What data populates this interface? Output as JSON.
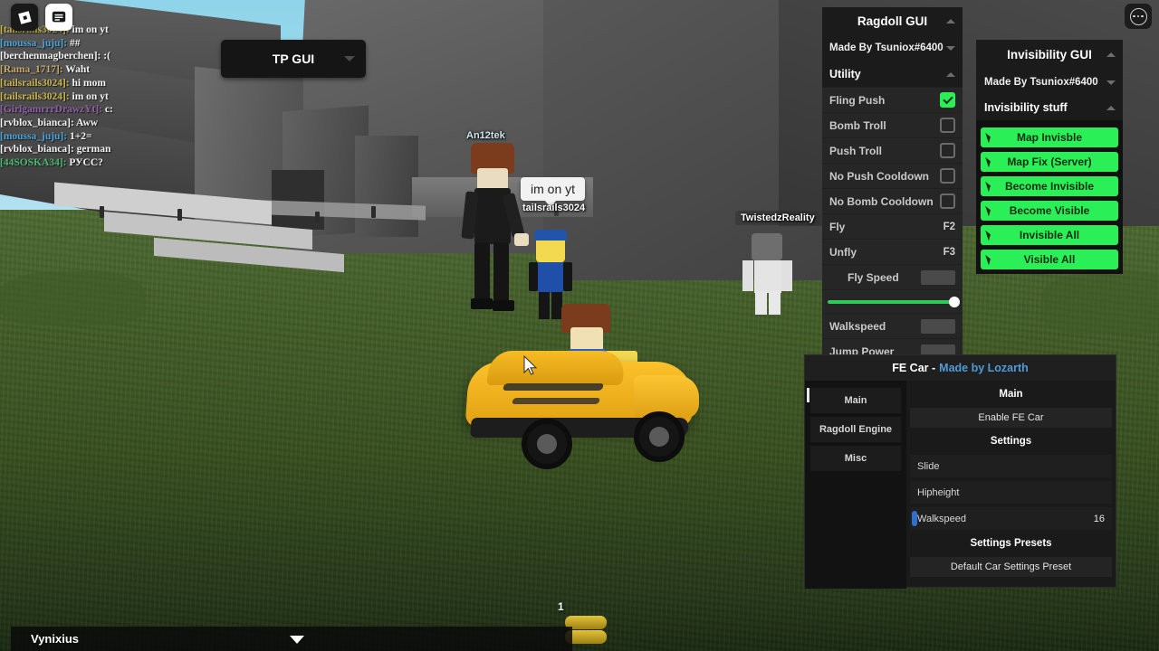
{
  "window": {
    "top_right_menu_icon": "ellipsis-circle-icon",
    "roblox_logo_icon": "roblox-logo-icon",
    "chat_toggle_icon": "chat-lines-icon"
  },
  "chat_log": {
    "lines": [
      {
        "name": "[tailsrails3024]:",
        "message": "im on yt",
        "color": "#c9b44a"
      },
      {
        "name": "[moussa_juju]:",
        "message": "##",
        "color": "#4aa3d8"
      },
      {
        "name": "[berchenmagberchen]:",
        "message": ":(",
        "color": "#f2f2f2"
      },
      {
        "name": "[Rama_1717]:",
        "message": "Waht",
        "color": "#c7a86a"
      },
      {
        "name": "[tailsrails3024]:",
        "message": "hi mom",
        "color": "#c9b44a"
      },
      {
        "name": "[tailsrails3024]:",
        "message": "im on yt",
        "color": "#c9b44a"
      },
      {
        "name": "[GirlgamrrrDrawzYt]:",
        "message": "c:",
        "color": "#8f5fa8"
      },
      {
        "name": "[rvblox_bianca]:",
        "message": "Aww",
        "color": "#f2f2f2"
      },
      {
        "name": "[moussa_juju]:",
        "message": "1+2=",
        "color": "#4aa3d8"
      },
      {
        "name": "[rvblox_bianca]:",
        "message": "german",
        "color": "#f2f2f2"
      },
      {
        "name": "[44SOSKA34]:",
        "message": "РУСС?",
        "color": "#46b96b"
      }
    ]
  },
  "tp_gui": {
    "label": "TP GUI",
    "caret_icon": "chevron-down-icon"
  },
  "world": {
    "nametags": [
      {
        "text": "An12tek"
      },
      {
        "text": "tailsrails3024"
      },
      {
        "text": "TwistedzReality"
      }
    ],
    "chat_bubble": "im on yt",
    "coin_count": "1"
  },
  "ragdoll_gui": {
    "title": "Ragdoll GUI",
    "author": "Made By Tsuniox#6400",
    "section": "Utility",
    "collapse_icon": "chevron-up-icon",
    "accent_color": "#2bef57",
    "toggles": [
      {
        "label": "Fling Push",
        "checked": true
      },
      {
        "label": "Bomb Troll",
        "checked": false
      },
      {
        "label": "Push Troll",
        "checked": false
      },
      {
        "label": "No Push Cooldown",
        "checked": false
      },
      {
        "label": "No Bomb Cooldown",
        "checked": false
      }
    ],
    "keybinds": [
      {
        "label": "Fly",
        "key": "F2"
      },
      {
        "label": "Unfly",
        "key": "F3"
      }
    ],
    "fly_speed": {
      "label": "Fly Speed",
      "value": ""
    },
    "fields": [
      {
        "label": "Walkspeed",
        "value": ""
      },
      {
        "label": "Jump Power",
        "value": ""
      }
    ]
  },
  "invisibility_gui": {
    "title": "Invisibility GUI",
    "author": "Made By Tsuniox#6400",
    "section": "Invisibility stuff",
    "collapse_icon": "chevron-up-icon",
    "accent_color": "#2bef57",
    "buttons": [
      {
        "label": "Map Invisble",
        "icon": "cursor-arrow-icon"
      },
      {
        "label": "Map Fix (Server)",
        "icon": "cursor-arrow-icon"
      },
      {
        "label": "Become Invisible",
        "icon": "cursor-arrow-icon"
      },
      {
        "label": "Become Visible",
        "icon": "cursor-arrow-icon"
      },
      {
        "label": "Invisible All",
        "icon": "cursor-arrow-icon"
      },
      {
        "label": "Visible All",
        "icon": "cursor-arrow-icon"
      }
    ]
  },
  "fe_car": {
    "title": "FE Car -",
    "author": "Made by Lozarth",
    "author_color": "#4f9bd6",
    "tabs": [
      {
        "label": "Main",
        "active": true
      },
      {
        "label": "Ragdoll Engine",
        "active": false
      },
      {
        "label": "Misc",
        "active": false
      }
    ],
    "sections": {
      "main_header": "Main",
      "main_action": "Enable FE Car",
      "settings_header": "Settings",
      "presets_header": "Settings Presets",
      "preset_action": "Default Car Settings Preset"
    },
    "settings_fields": [
      {
        "label": "Slide",
        "value": ""
      },
      {
        "label": "Hipheight",
        "value": ""
      },
      {
        "label": "Walkspeed",
        "value": "16",
        "focused": true
      }
    ]
  },
  "bottom_bar": {
    "player_name": "Vynixius",
    "expand_icon": "triangle-down-icon"
  }
}
